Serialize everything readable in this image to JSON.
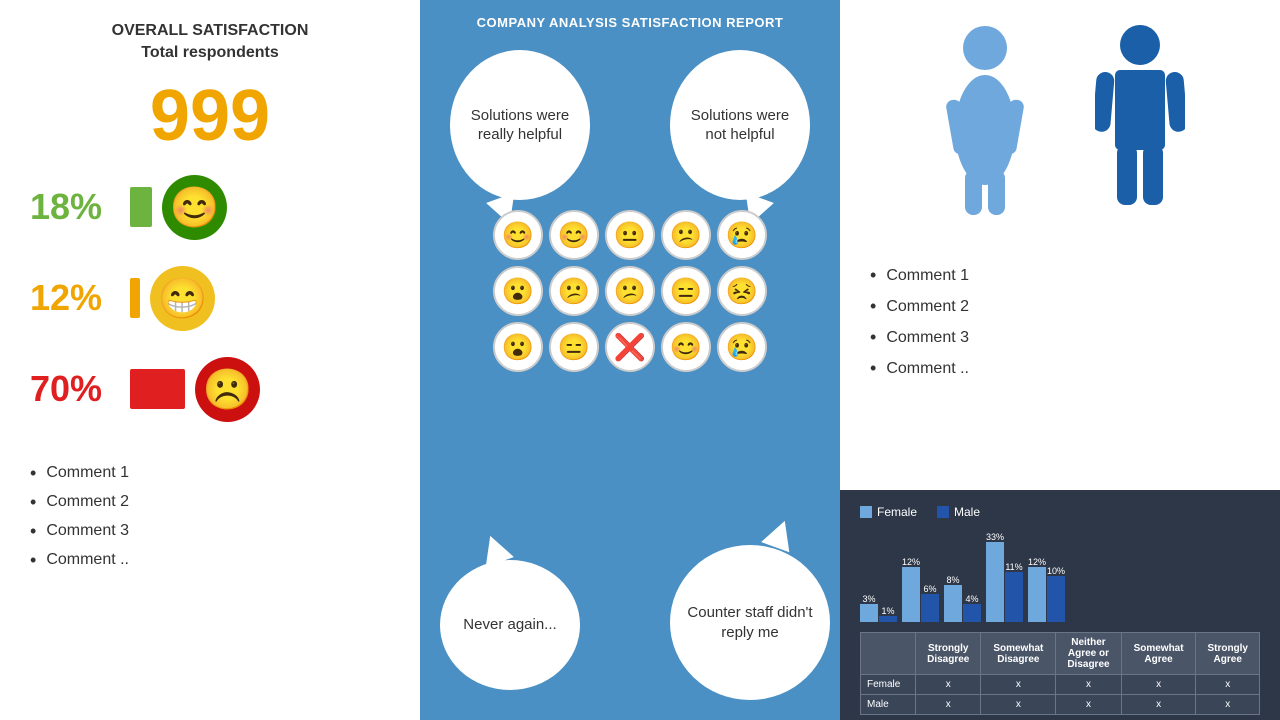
{
  "left": {
    "overall_title": "OVERALL SATISFACTION",
    "total_label": "Total respondents",
    "total_number": "999",
    "satisfactions": [
      {
        "pct": "18%",
        "color_class": "pct-green",
        "bar_class": "bar-green",
        "face": "😊"
      },
      {
        "pct": "12%",
        "color_class": "pct-yellow",
        "bar_class": "bar-yellow",
        "face": "😁"
      },
      {
        "pct": "70%",
        "color_class": "pct-red",
        "bar_class": "bar-red",
        "face": "☹"
      }
    ],
    "comments": [
      "Comment 1",
      "Comment 2",
      "Comment 3",
      "Comment .."
    ]
  },
  "middle": {
    "title": "COMPANY ANALYSIS SATISFACTION REPORT",
    "bubble_top_left": "Solutions were really helpful",
    "bubble_top_right": "Solutions were not helpful",
    "bubble_bottom_left": "Never again...",
    "bubble_bottom_right": "Counter staff didn't reply me",
    "emojis": [
      "😊",
      "😊",
      "😐",
      "😕",
      "😢",
      "😮",
      "😕",
      "😕",
      "😑",
      "😣",
      "😮",
      "😑",
      "❌",
      "😊",
      "😢"
    ]
  },
  "right": {
    "comments": [
      "Comment 1",
      "Comment 2",
      "Comment 3",
      "Comment .."
    ],
    "chart": {
      "legend_female": "Female",
      "legend_male": "Male",
      "groups": [
        {
          "label": "Strongly\nDisagree",
          "female_pct": 3,
          "male_pct": 1,
          "female_label": "3%",
          "male_label": "1%"
        },
        {
          "label": "Somewhat\nDisagree",
          "female_pct": 12,
          "male_pct": 6,
          "female_label": "12%",
          "male_label": "6%"
        },
        {
          "label": "Neither\nAgree or\nDisagree",
          "female_pct": 8,
          "male_pct": 4,
          "female_label": "8%",
          "male_label": "4%"
        },
        {
          "label": "Somewhat\nAgree",
          "female_pct": 33,
          "male_pct": 11,
          "female_label": "33%",
          "male_label": "11%"
        },
        {
          "label": "Strongly\nAgree",
          "female_pct": 12,
          "male_pct": 10,
          "female_label": "12%",
          "male_label": "10%"
        }
      ],
      "table_headers": [
        "",
        "Strongly\nDisagree",
        "Somewhat\nDisagree",
        "Neither\nAgree or\nDisagree",
        "Somewhat\nAgree",
        "Strongly\nAgree"
      ],
      "rows": [
        {
          "label": "Female",
          "values": [
            "x",
            "x",
            "x",
            "x",
            "x"
          ]
        },
        {
          "label": "Male",
          "values": [
            "x",
            "x",
            "x",
            "x",
            "x"
          ]
        }
      ]
    }
  }
}
